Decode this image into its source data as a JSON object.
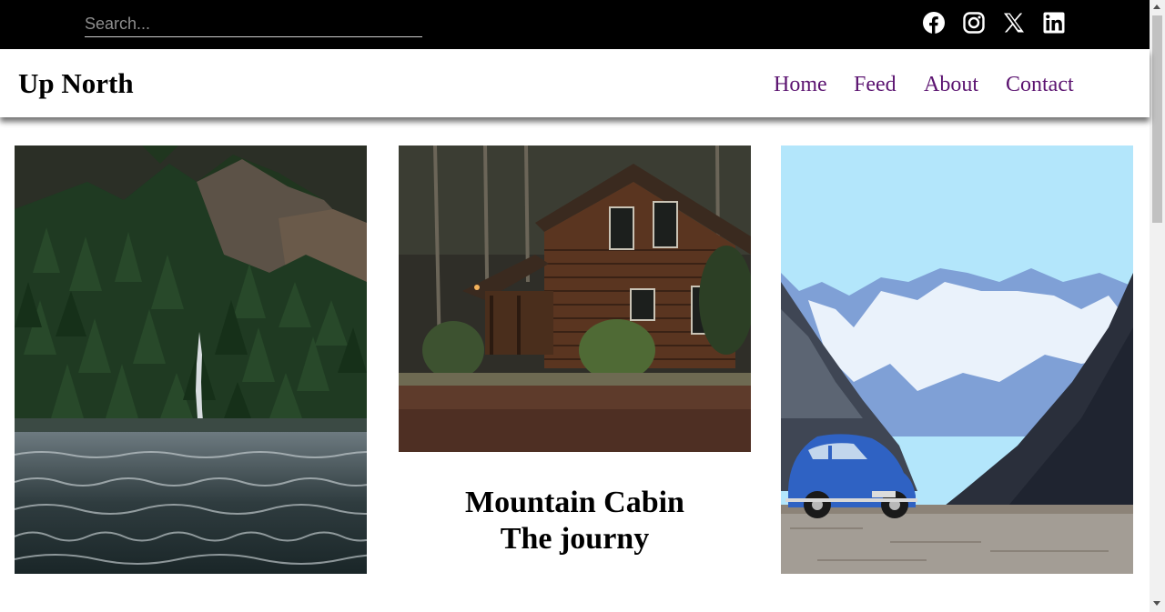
{
  "topbar": {
    "search": {
      "placeholder": "Search...",
      "value": ""
    },
    "social": [
      {
        "name": "facebook-icon"
      },
      {
        "name": "instagram-icon"
      },
      {
        "name": "x-icon"
      },
      {
        "name": "linkedin-icon"
      }
    ]
  },
  "header": {
    "brand": "Up North",
    "nav": [
      "Home",
      "Feed",
      "About",
      "Contact"
    ]
  },
  "cards": [
    {
      "image": "waterfall-lake-photo",
      "caption": null
    },
    {
      "image": "log-cabin-photo",
      "caption": {
        "line1": "Mountain Cabin",
        "line2": "The journy"
      }
    },
    {
      "image": "blue-car-mountains-photo",
      "caption": null
    }
  ],
  "colors": {
    "topbar_bg": "#000000",
    "nav_link": "#5b1370",
    "brand": "#000000"
  }
}
